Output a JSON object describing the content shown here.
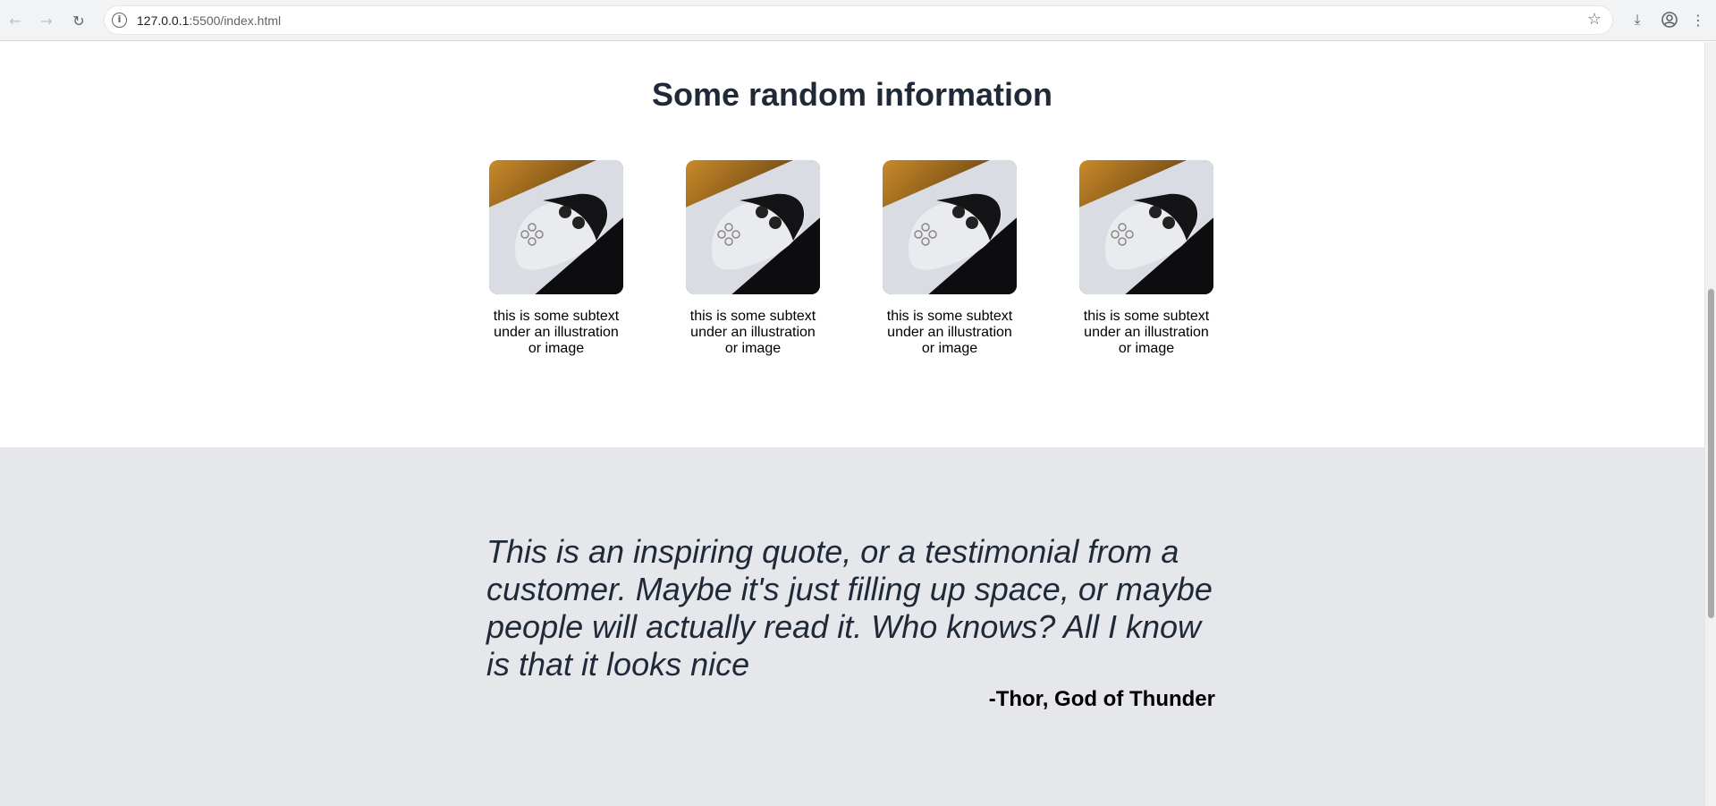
{
  "browser": {
    "url_host": "127.0.0.1",
    "url_path": ":5500/index.html"
  },
  "page": {
    "info_title": "Some random information",
    "cards": [
      {
        "caption": "this is some subtext under an illustration or image"
      },
      {
        "caption": "this is some subtext under an illustration or image"
      },
      {
        "caption": "this is some subtext under an illustration or image"
      },
      {
        "caption": "this is some subtext under an illustration or image"
      }
    ],
    "quote": "This is an inspiring quote, or a testimonial from a customer. Maybe it's just filling up space, or maybe people will actually read it. Who knows? All I know is that it looks nice",
    "author": "-Thor, God of Thunder"
  },
  "colors": {
    "heading": "#1f2937",
    "quote_bg": "#e5e7eb"
  }
}
